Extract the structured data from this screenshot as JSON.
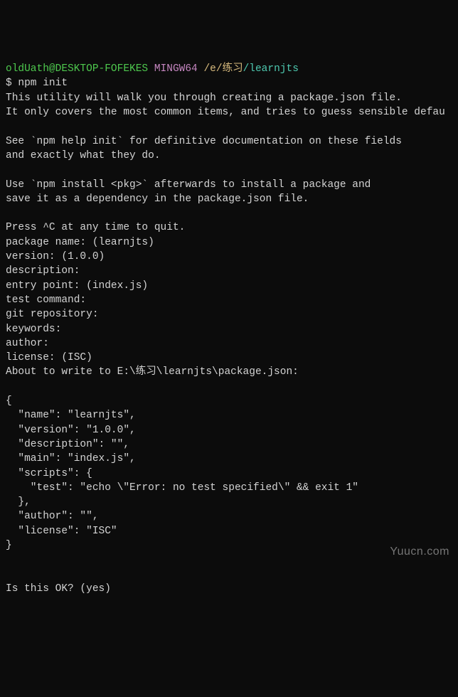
{
  "prompt": {
    "user": "oldUath@DESKTOP-FOFEKES",
    "shell": "MINGW64",
    "path_root": "/e/练习",
    "path_sub": "/learnjts",
    "symbol": "$",
    "command": "npm init"
  },
  "lines": {
    "intro1": "This utility will walk you through creating a package.json file.",
    "intro2": "It only covers the most common items, and tries to guess sensible defau",
    "help1": "See `npm help init` for definitive documentation on these fields",
    "help2": "and exactly what they do.",
    "install1": "Use `npm install <pkg>` afterwards to install a package and",
    "install2": "save it as a dependency in the package.json file.",
    "quit": "Press ^C at any time to quit.",
    "pkg_name": "package name: (learnjts)",
    "version": "version: (1.0.0)",
    "description": "description:",
    "entry": "entry point: (index.js)",
    "test_cmd": "test command:",
    "git_repo": "git repository:",
    "keywords": "keywords:",
    "author": "author:",
    "license": "license: (ISC)",
    "about_write": "About to write to E:\\练习\\learnjts\\package.json:",
    "json_open": "{",
    "json_name": "  \"name\": \"learnjts\",",
    "json_version": "  \"version\": \"1.0.0\",",
    "json_desc": "  \"description\": \"\",",
    "json_main": "  \"main\": \"index.js\",",
    "json_scripts_open": "  \"scripts\": {",
    "json_test": "    \"test\": \"echo \\\"Error: no test specified\\\" && exit 1\"",
    "json_scripts_close": "  },",
    "json_author": "  \"author\": \"\",",
    "json_license": "  \"license\": \"ISC\"",
    "json_close": "}",
    "confirm": "Is this OK? (yes)"
  },
  "watermark": "Yuucn.com"
}
